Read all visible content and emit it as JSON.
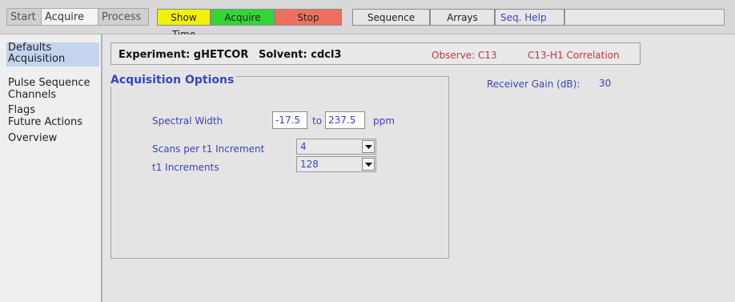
{
  "tabs": {
    "start": "Start",
    "acquire": "Acquire",
    "process": "Process"
  },
  "buttons": {
    "show_time": "Show Time",
    "acquire": "Acquire",
    "stop": "Stop",
    "sequence": "Sequence",
    "arrays": "Arrays",
    "seq_help": "Seq. Help"
  },
  "sidebar": {
    "items": [
      "Defaults",
      "Acquisition",
      "Pulse Sequence",
      "Channels",
      "Flags",
      "Future Actions",
      "Overview"
    ]
  },
  "experiment": {
    "label": "Experiment: gHETCOR",
    "solvent": "Solvent: cdcl3",
    "observe": "Observe: C13",
    "correlation": "C13-H1 Correlation"
  },
  "receiver": {
    "label": "Receiver Gain (dB):",
    "value": "30"
  },
  "acq": {
    "title": "Acquisition Options",
    "spectral_width_label": "Spectral Width",
    "sw_from": "-17.5",
    "to_label": "to",
    "sw_to": "237.5",
    "ppm_label": "ppm",
    "scans_label": "Scans per t1 Increment",
    "scans_value": "4",
    "t1_label": "t1 Increments",
    "t1_value": "128"
  },
  "colors": {
    "show_time": "#f2f200",
    "acquire": "#33d633",
    "stop": "#f07060"
  },
  "icons": {
    "dropdown": "chevron-down-icon"
  }
}
